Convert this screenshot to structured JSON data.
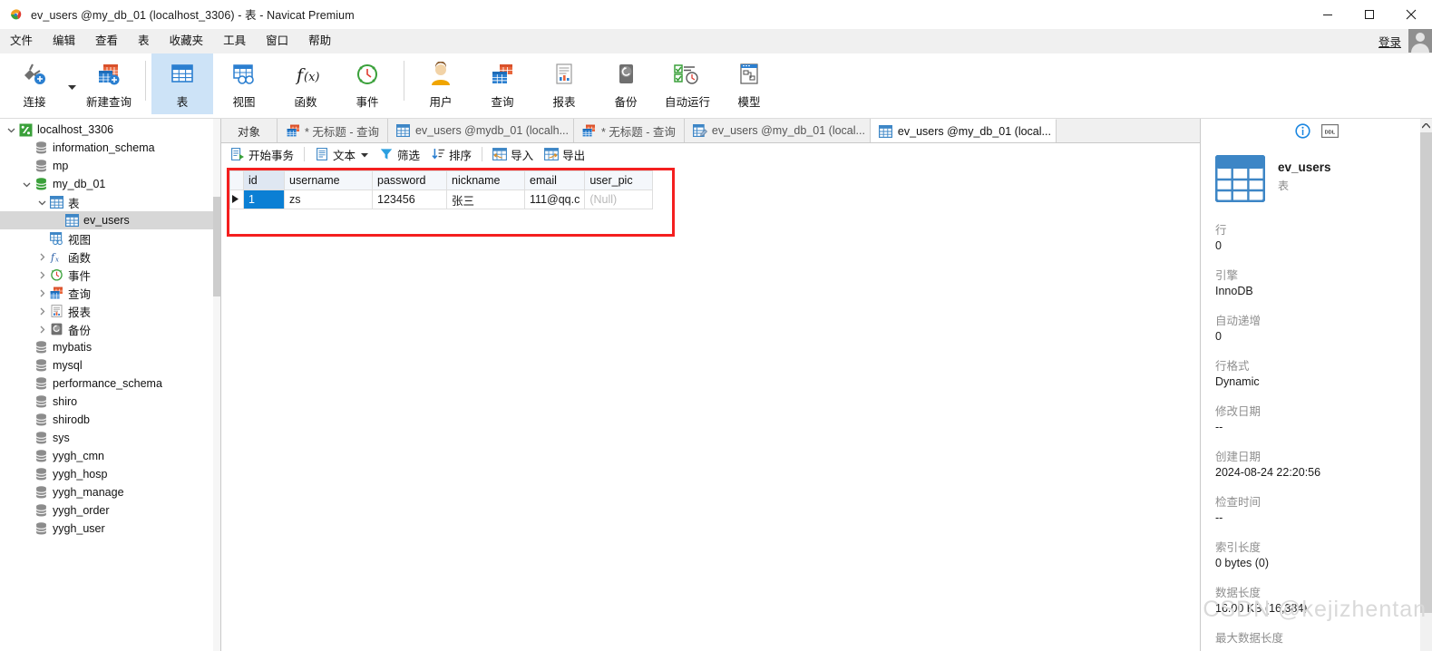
{
  "window": {
    "title": "ev_users @my_db_01 (localhost_3306) - 表 - Navicat Premium",
    "app_icon": "navicat-logo-icon",
    "minimize": "minimize-icon",
    "maximize": "maximize-icon",
    "close": "close-icon"
  },
  "menubar": {
    "items": [
      {
        "label": "文件"
      },
      {
        "label": "编辑"
      },
      {
        "label": "查看"
      },
      {
        "label": "表"
      },
      {
        "label": "收藏夹"
      },
      {
        "label": "工具"
      },
      {
        "label": "窗口"
      },
      {
        "label": "帮助"
      }
    ],
    "login_label": "登录",
    "avatar": "user-avatar-icon"
  },
  "toolbar": {
    "items": [
      {
        "label": "连接",
        "icon": "connection-icon",
        "active": false,
        "has_caret": true
      },
      {
        "label": "新建查询",
        "icon": "new-query-icon",
        "active": false,
        "has_caret": false
      },
      {
        "label": "表",
        "icon": "table-icon",
        "active": true,
        "has_caret": false
      },
      {
        "label": "视图",
        "icon": "view-icon",
        "active": false,
        "has_caret": false
      },
      {
        "label": "函数",
        "icon": "function-icon",
        "active": false,
        "has_caret": false
      },
      {
        "label": "事件",
        "icon": "event-clock-icon",
        "active": false,
        "has_caret": false
      },
      {
        "label": "用户",
        "icon": "user-icon",
        "active": false,
        "has_caret": false
      },
      {
        "label": "查询",
        "icon": "query-icon",
        "active": false,
        "has_caret": false
      },
      {
        "label": "报表",
        "icon": "report-icon",
        "active": false,
        "has_caret": false
      },
      {
        "label": "备份",
        "icon": "backup-icon",
        "active": false,
        "has_caret": false
      },
      {
        "label": "自动运行",
        "icon": "automation-icon",
        "active": false,
        "has_caret": false
      },
      {
        "label": "模型",
        "icon": "model-icon",
        "active": false,
        "has_caret": false
      }
    ]
  },
  "sidebar": {
    "nodes": [
      {
        "label": "localhost_3306",
        "icon": "connection-green-icon",
        "indent": 0,
        "twist": "down",
        "selected": false
      },
      {
        "label": "information_schema",
        "icon": "database-icon",
        "indent": 1,
        "twist": "",
        "selected": false
      },
      {
        "label": "mp",
        "icon": "database-icon",
        "indent": 1,
        "twist": "",
        "selected": false
      },
      {
        "label": "my_db_01",
        "icon": "database-green-icon",
        "indent": 1,
        "twist": "down",
        "selected": false
      },
      {
        "label": "表",
        "icon": "table-folder-icon",
        "indent": 2,
        "twist": "down",
        "selected": false
      },
      {
        "label": "ev_users",
        "icon": "table-icon",
        "indent": 3,
        "twist": "",
        "selected": true
      },
      {
        "label": "视图",
        "icon": "view-folder-icon",
        "indent": 2,
        "twist": "",
        "selected": false
      },
      {
        "label": "函数",
        "icon": "function-folder-icon",
        "indent": 2,
        "twist": "right",
        "selected": false
      },
      {
        "label": "事件",
        "icon": "event-folder-icon",
        "indent": 2,
        "twist": "right",
        "selected": false
      },
      {
        "label": "查询",
        "icon": "query-folder-icon",
        "indent": 2,
        "twist": "right",
        "selected": false
      },
      {
        "label": "报表",
        "icon": "report-folder-icon",
        "indent": 2,
        "twist": "right",
        "selected": false
      },
      {
        "label": "备份",
        "icon": "backup-folder-icon",
        "indent": 2,
        "twist": "right",
        "selected": false
      },
      {
        "label": "mybatis",
        "icon": "database-icon",
        "indent": 1,
        "twist": "",
        "selected": false
      },
      {
        "label": "mysql",
        "icon": "database-icon",
        "indent": 1,
        "twist": "",
        "selected": false
      },
      {
        "label": "performance_schema",
        "icon": "database-icon",
        "indent": 1,
        "twist": "",
        "selected": false
      },
      {
        "label": "shiro",
        "icon": "database-icon",
        "indent": 1,
        "twist": "",
        "selected": false
      },
      {
        "label": "shirodb",
        "icon": "database-icon",
        "indent": 1,
        "twist": "",
        "selected": false
      },
      {
        "label": "sys",
        "icon": "database-icon",
        "indent": 1,
        "twist": "",
        "selected": false
      },
      {
        "label": "yygh_cmn",
        "icon": "database-icon",
        "indent": 1,
        "twist": "",
        "selected": false
      },
      {
        "label": "yygh_hosp",
        "icon": "database-icon",
        "indent": 1,
        "twist": "",
        "selected": false
      },
      {
        "label": "yygh_manage",
        "icon": "database-icon",
        "indent": 1,
        "twist": "",
        "selected": false
      },
      {
        "label": "yygh_order",
        "icon": "database-icon",
        "indent": 1,
        "twist": "",
        "selected": false
      },
      {
        "label": "yygh_user",
        "icon": "database-icon",
        "indent": 1,
        "twist": "",
        "selected": false
      }
    ]
  },
  "tabs": [
    {
      "label": "对象",
      "icon": "",
      "active": false,
      "kind": "objects"
    },
    {
      "label": "* 无标题 - 查询",
      "icon": "query-tab-icon",
      "active": false,
      "kind": "query"
    },
    {
      "label": "ev_users @mydb_01 (localh...",
      "icon": "table-tab-icon",
      "active": false,
      "kind": "table"
    },
    {
      "label": "* 无标题 - 查询",
      "icon": "query-tab-icon",
      "active": false,
      "kind": "query"
    },
    {
      "label": "ev_users @my_db_01 (local...",
      "icon": "table-design-tab-icon",
      "active": false,
      "kind": "design"
    },
    {
      "label": "ev_users @my_db_01 (local...",
      "icon": "table-tab-icon",
      "active": true,
      "kind": "table"
    }
  ],
  "grid_toolbar": {
    "items": [
      {
        "label": "开始事务",
        "icon": "transaction-icon",
        "caret": false
      },
      {
        "label": "文本",
        "icon": "text-icon",
        "caret": true
      },
      {
        "label": "筛选",
        "icon": "filter-icon",
        "caret": false
      },
      {
        "label": "排序",
        "icon": "sort-icon",
        "caret": false
      },
      {
        "label": "导入",
        "icon": "import-icon",
        "caret": false
      },
      {
        "label": "导出",
        "icon": "export-icon",
        "caret": false
      }
    ]
  },
  "grid": {
    "columns": [
      "id",
      "username",
      "password",
      "nickname",
      "email",
      "user_pic"
    ],
    "rows": [
      {
        "id": "1",
        "username": "zs",
        "password": "123456",
        "nickname": "张三",
        "email": "111@qq.c",
        "user_pic": "(Null)"
      }
    ]
  },
  "info_panel": {
    "info_icon": "info-circle-icon",
    "ddl_label": "DDL",
    "object_icon": "table-large-icon",
    "object_name": "ev_users",
    "object_type": "表",
    "fields": [
      {
        "label": "行",
        "value": "0"
      },
      {
        "label": "引擎",
        "value": "InnoDB"
      },
      {
        "label": "自动递增",
        "value": "0"
      },
      {
        "label": "行格式",
        "value": "Dynamic"
      },
      {
        "label": "修改日期",
        "value": "--"
      },
      {
        "label": "创建日期",
        "value": "2024-08-24 22:20:56"
      },
      {
        "label": "检查时间",
        "value": "--"
      },
      {
        "label": "索引长度",
        "value": "0 bytes (0)"
      },
      {
        "label": "数据长度",
        "value": "16.00 KB (16,384)"
      },
      {
        "label": "最大数据长度",
        "value": ""
      }
    ]
  },
  "watermark": "CSDN @kejizhentan",
  "colors": {
    "accent": "#0b7fd4",
    "annotation": "#f41f1f",
    "toolbar_active": "#cde3f7",
    "tree_selected": "#d7d7d7"
  }
}
